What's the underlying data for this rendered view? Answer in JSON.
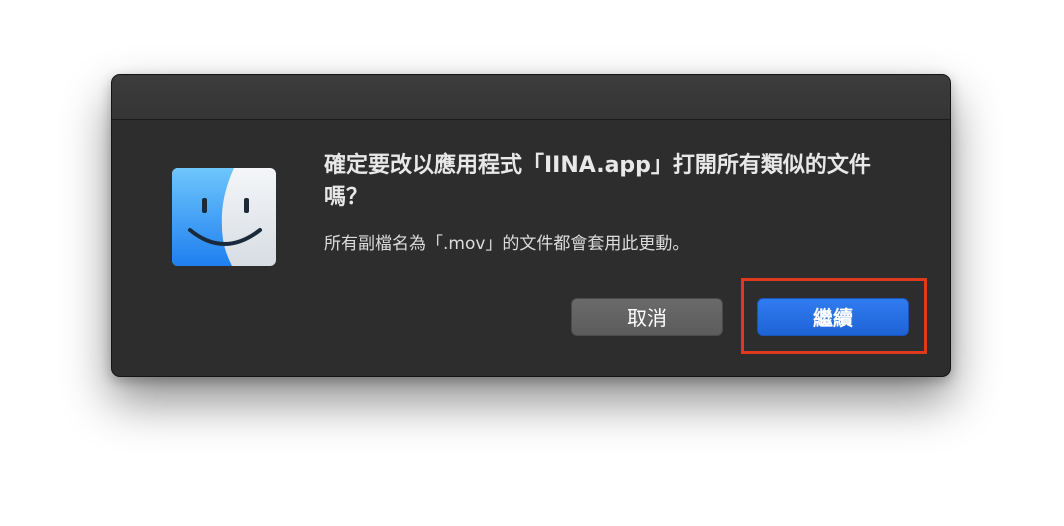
{
  "dialog": {
    "app_icon": "finder-icon",
    "message": "確定要改以應用程式「IINA.app」打開所有類似的文件嗎？",
    "informative_text": "所有副檔名為「.mov」的文件都會套用此更動。",
    "cancel_label": "取消",
    "continue_label": "繼續"
  },
  "colors": {
    "dialog_background": "#2d2d2d",
    "default_button": "#2f7cf0",
    "cancel_button": "#6a6a6a",
    "highlight": "#e03a1e"
  }
}
